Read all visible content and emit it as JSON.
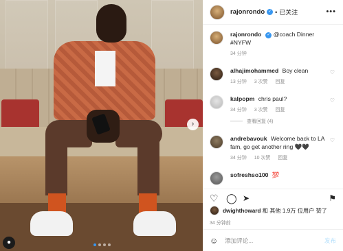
{
  "header": {
    "username": "rajonrondo",
    "separator": "•",
    "follow_status": "已关注"
  },
  "caption": {
    "username": "rajonrondo",
    "text": "@coach Dinner #NYFW",
    "time": "34 分钟"
  },
  "comments": [
    {
      "username": "alhajimohammed",
      "text": "Boy clean",
      "time": "13 分钟",
      "likes": "3 次赞",
      "reply": "回复"
    },
    {
      "username": "kalpopm",
      "text": "chris paul?",
      "time": "34 分钟",
      "likes": "3 次赞",
      "reply": "回复",
      "view_replies": "查看回复 (4)"
    },
    {
      "username": "andrebavouk",
      "text": "Welcome back to LA fam, go get another ring 🖤🖤",
      "time": "34 分钟",
      "likes": "10 次赞",
      "reply": "回复"
    },
    {
      "username": "sofreshso100",
      "text": "💯"
    }
  ],
  "actions": {
    "like_icon": "heart-outline",
    "comment_icon": "speech-bubble",
    "share_icon": "paper-plane",
    "save_icon": "bookmark"
  },
  "likes": {
    "user": "dwighthoward",
    "text": " 和 其他 1.9万 位用户 赞了"
  },
  "post_time": "34 分钟前",
  "comment_box": {
    "placeholder": "添加评论...",
    "post_label": "发布"
  },
  "carousel": {
    "total": 4,
    "active": 1
  },
  "colors": {
    "accent": "#3897f0",
    "muted": "#8e8e8e",
    "text": "#262626"
  }
}
